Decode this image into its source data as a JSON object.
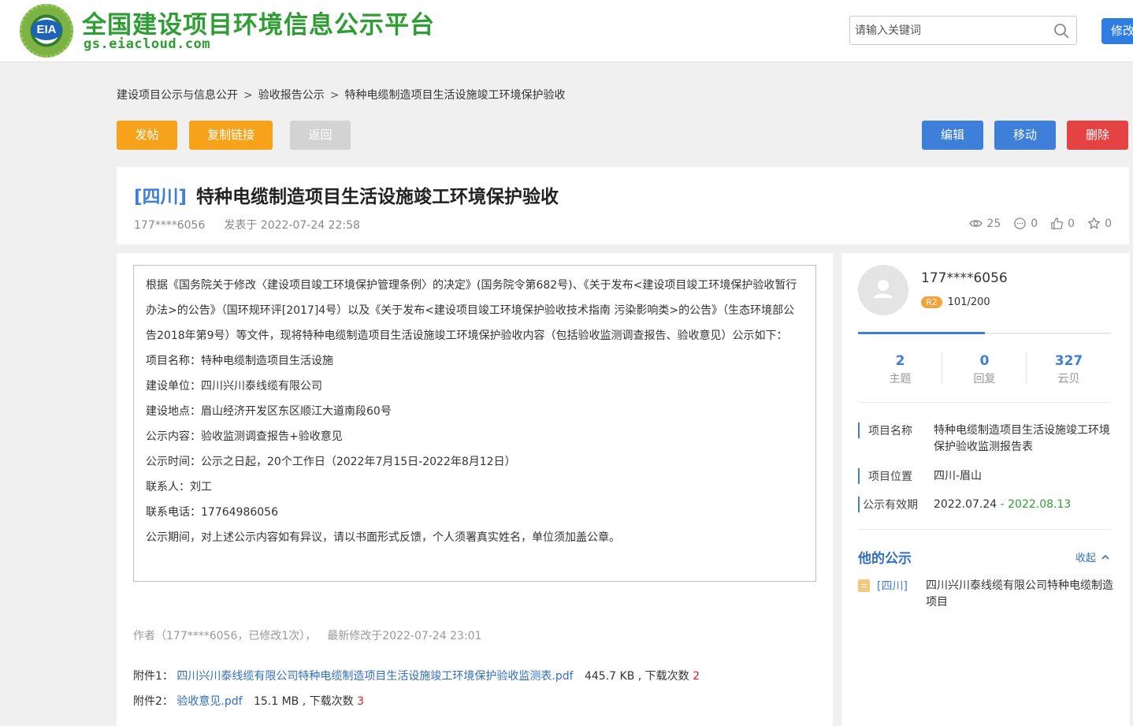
{
  "header": {
    "logo_text": "EIA",
    "site_title": "全国建设项目环境信息公示平台",
    "site_domain": "gs.eiacloud.com",
    "search_placeholder": "请输入关键词",
    "edit_button": "修改"
  },
  "breadcrumb": [
    "建设项目公示与信息公开",
    "验收报告公示",
    "特种电缆制造项目生活设施竣工环境保护验收"
  ],
  "breadcrumb_separator": ">",
  "toolbar": {
    "post": "发帖",
    "copy_link": "复制链接",
    "back": "返回",
    "edit": "编辑",
    "move": "移动",
    "delete": "删除"
  },
  "post": {
    "region": "[四川]",
    "title": "特种电缆制造项目生活设施竣工环境保护验收",
    "author": "177****6056",
    "published": "发表于 2022-07-24 22:58",
    "views": "25",
    "comments": "0",
    "likes": "0",
    "favorites": "0",
    "body": [
      "根据《国务院关于修改〈建设项目竣工环境保护管理条例〉的决定》(国务院令第682号)、《关于发布<建设项目竣工环境保护验收暂行办法>的公告》（国环规环评[2017]4号）以及《关于发布<建设项目竣工环境保护验收技术指南 污染影响类>的公告》（生态环境部公告2018年第9号）等文件，现将特种电缆制造项目生活设施竣工环境保护验收内容（包括验收监测调查报告、验收意见）公示如下：",
      "项目名称：特种电缆制造项目生活设施",
      "建设单位：四川兴川泰线缆有限公司",
      "建设地点：眉山经济开发区东区顺江大道南段60号",
      "公示内容：验收监测调查报告+验收意见",
      "公示时间：公示之日起，20个工作日（2022年7月15日-2022年8月12日）",
      "联系人：刘工",
      "联系电话：17764986056",
      "公示期间，对上述公示内容如有异议，请以书面形式反馈，个人须署真实姓名，单位须加盖公章。"
    ],
    "author_line": "作者（177****6056，已修改1次），",
    "modified_line": "最新修改于2022-07-24 23:01",
    "attachments": [
      {
        "label": "附件1：",
        "name": "四川兴川泰线缆有限公司特种电缆制造项目生活设施竣工环境保护验收监测表.pdf",
        "size": "445.7 KB , 下载次数",
        "downloads": "2"
      },
      {
        "label": "附件2：",
        "name": "验收意见.pdf",
        "size": "15.1 MB , 下载次数",
        "downloads": "3"
      }
    ]
  },
  "sidebar": {
    "username": "177****6056",
    "level_badge": "R2",
    "level_progress": "101/200",
    "counts": [
      {
        "value": "2",
        "label": "主题"
      },
      {
        "value": "0",
        "label": "回复"
      },
      {
        "value": "327",
        "label": "云贝"
      }
    ],
    "project_name_label": "项目名称",
    "project_name_value": "特种电缆制造项目生活设施竣工环境保护验收监测报告表",
    "project_location_label": "项目位置",
    "project_location_value": "四川-眉山",
    "validity_label": "公示有效期",
    "validity_start": "2022.07.24",
    "validity_dash": " - ",
    "validity_end": "2022.08.13",
    "their_posts_title": "他的公示",
    "collapse_label": "收起",
    "their_posts": [
      {
        "region": "[四川]",
        "title": "四川兴川泰线缆有限公司特种电缆制造项目"
      }
    ]
  },
  "colors": {
    "brand_green": "#2e9d33",
    "accent_blue": "#3d7fd9",
    "orange": "#f7a21b",
    "red": "#e54343"
  }
}
